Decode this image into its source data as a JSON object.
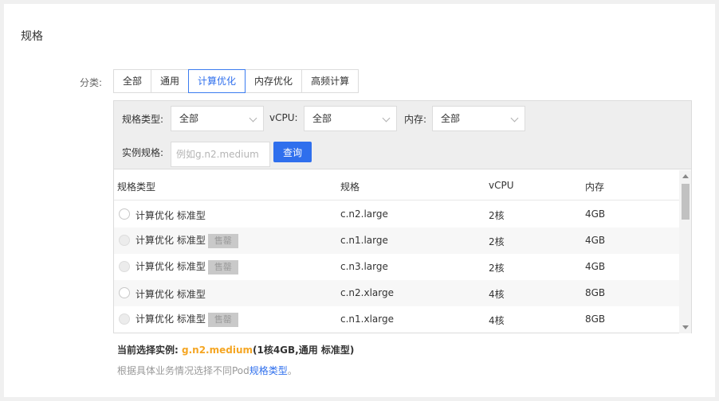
{
  "section": {
    "title": "规格"
  },
  "category": {
    "label": "分类:",
    "tabs": [
      {
        "label": "全部"
      },
      {
        "label": "通用"
      },
      {
        "label": "计算优化",
        "active": true
      },
      {
        "label": "内存优化"
      },
      {
        "label": "高频计算"
      }
    ]
  },
  "filters": {
    "spec_type": {
      "label": "规格类型:",
      "value": "全部"
    },
    "vcpu": {
      "label": "vCPU:",
      "value": "全部"
    },
    "memory": {
      "label": "内存:",
      "value": "全部"
    },
    "instance": {
      "label": "实例规格:",
      "placeholder": "例如g.n2.medium"
    },
    "query_label": "查询"
  },
  "table": {
    "headers": {
      "type": "规格类型",
      "spec": "规格",
      "vcpu": "vCPU",
      "memory": "内存"
    },
    "rows": [
      {
        "type": "计算优化 标准型",
        "badge": "",
        "spec": "c.n2.large",
        "vcpu": "2核",
        "memory": "4GB"
      },
      {
        "type": "计算优化 标准型",
        "badge": "售罄",
        "spec": "c.n1.large",
        "vcpu": "2核",
        "memory": "4GB"
      },
      {
        "type": "计算优化 标准型",
        "badge": "售罄",
        "spec": "c.n3.large",
        "vcpu": "2核",
        "memory": "4GB"
      },
      {
        "type": "计算优化 标准型",
        "badge": "",
        "spec": "c.n2.xlarge",
        "vcpu": "4核",
        "memory": "8GB"
      },
      {
        "type": "计算优化 标准型",
        "badge": "售罄",
        "spec": "c.n1.xlarge",
        "vcpu": "4核",
        "memory": "8GB"
      }
    ]
  },
  "selection": {
    "prefix": "当前选择实例:",
    "value": "g.n2.medium",
    "detail": "(1核4GB,通用 标准型)"
  },
  "hint": {
    "text": "根据具体业务情况选择不同Pod",
    "link": "规格类型",
    "suffix": "。"
  },
  "colors": {
    "accent": "#2f6fed",
    "highlight": "#f5a623"
  }
}
